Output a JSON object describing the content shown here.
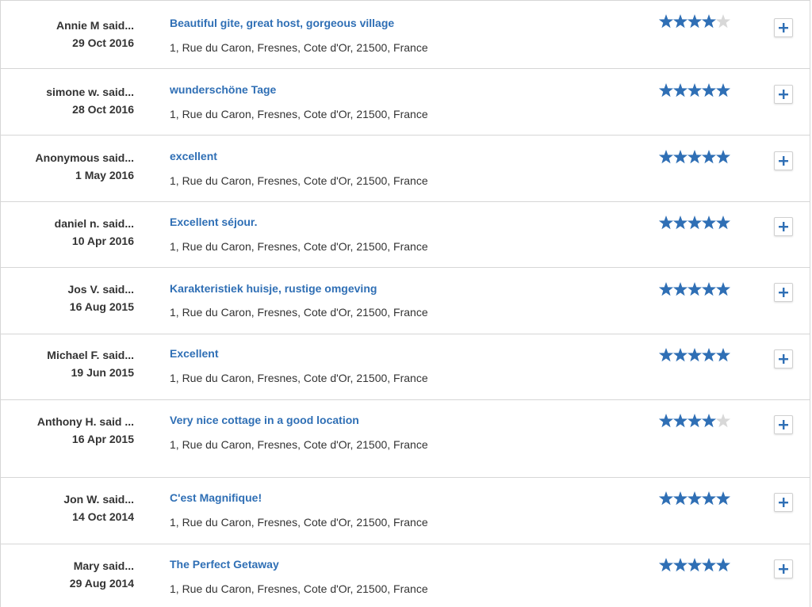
{
  "colors": {
    "accent": "#2f6fb5",
    "star_filled": "#2f6fb5",
    "star_empty": "#d8d8d8",
    "text": "#333333",
    "divider": "#d6d6d6"
  },
  "reviews": [
    {
      "author": "Annie M said...",
      "date": "29 Oct 2016",
      "title": "Beautiful gite, great host, gorgeous village",
      "address": "1, Rue du Caron, Fresnes, Cote d'Or, 21500, France",
      "rating": 4
    },
    {
      "author": "simone w. said...",
      "date": "28 Oct 2016",
      "title": "wunderschöne Tage",
      "address": "1, Rue du Caron, Fresnes, Cote d'Or, 21500, France",
      "rating": 5
    },
    {
      "author": "Anonymous said...",
      "date": "1 May 2016",
      "title": "excellent",
      "address": "1, Rue du Caron, Fresnes, Cote d'Or, 21500, France",
      "rating": 5
    },
    {
      "author": "daniel n. said...",
      "date": "10 Apr 2016",
      "title": "Excellent séjour.",
      "address": "1, Rue du Caron, Fresnes, Cote d'Or, 21500, France",
      "rating": 5
    },
    {
      "author": "Jos V. said...",
      "date": "16 Aug 2015",
      "title": "Karakteristiek huisje, rustige omgeving",
      "address": "1, Rue du Caron, Fresnes, Cote d'Or, 21500, France",
      "rating": 5
    },
    {
      "author": "Michael F.   said...",
      "date": "19 Jun 2015",
      "title": "Excellent",
      "address": "1, Rue du Caron, Fresnes, Cote d'Or, 21500, France",
      "rating": 5
    },
    {
      "author": "Anthony H.          said ...",
      "date": "16 Apr 2015",
      "title": "Very nice cottage in a good location",
      "address": "1, Rue du Caron, Fresnes, Cote d'Or, 21500, France",
      "rating": 4
    },
    {
      "author": "Jon W.            said...",
      "date": "14 Oct 2014",
      "title": "C'est Magnifique!",
      "address": "1, Rue du Caron, Fresnes, Cote d'Or, 21500, France",
      "rating": 5
    },
    {
      "author": "Mary said...",
      "date": "29 Aug 2014",
      "title": "The Perfect Getaway",
      "address": "1, Rue du Caron, Fresnes, Cote d'Or, 21500, France",
      "rating": 5
    }
  ],
  "icons": {
    "star": "star-icon",
    "expand": "plus-icon"
  }
}
